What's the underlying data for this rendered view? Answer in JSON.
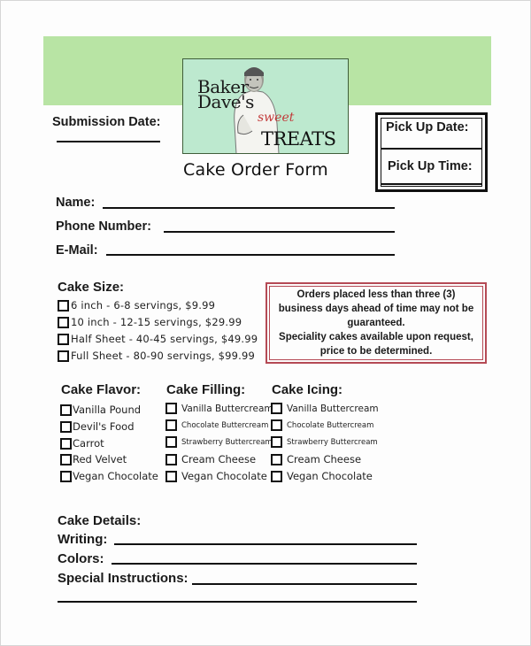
{
  "header": {
    "logo": {
      "line1": "Baker",
      "line2": "Dave's",
      "sweet": "sweet",
      "treats": "TREATS",
      "icon": "chef-photo"
    },
    "form_title": "Cake Order Form",
    "colors": {
      "band": "#b8e4a4",
      "logo_bg": "#bde9cf",
      "sweet_text": "#c23a3a",
      "note_border": "#b54a55"
    }
  },
  "submission": {
    "label": "Submission Date:"
  },
  "pickup": {
    "date_label": "Pick Up Date:",
    "time_label": "Pick Up Time:"
  },
  "contact": {
    "name_label": "Name:",
    "phone_label": "Phone Number:",
    "email_label": "E-Mail:"
  },
  "cake_size": {
    "heading": "Cake Size:",
    "options": [
      "6 inch - 6-8 servings, $9.99",
      "10 inch - 12-15 servings, $29.99",
      "Half Sheet - 40-45 servings, $49.99",
      "Full Sheet - 80-90 servings, $99.99"
    ]
  },
  "notice": {
    "line1": "Orders placed less than three (3)",
    "line2": "business days ahead of time may not be",
    "line3": "guaranteed.",
    "line4": "Speciality cakes available upon request,",
    "line5": "price to be determined."
  },
  "flavor": {
    "heading": "Cake Flavor:",
    "options": [
      "Vanilla Pound",
      "Devil's Food",
      "Carrot",
      "Red Velvet",
      "Vegan Chocolate"
    ]
  },
  "filling": {
    "heading": "Cake Filling:",
    "options": [
      "Vanilla Buttercream",
      "Chocolate Buttercream",
      "Strawberry Buttercream",
      "Cream Cheese",
      "Vegan Chocolate"
    ]
  },
  "icing": {
    "heading": "Cake Icing:",
    "options": [
      "Vanilla Buttercream",
      "Chocolate Buttercream",
      "Strawberry Buttercream",
      "Cream Cheese",
      "Vegan Chocolate"
    ]
  },
  "details": {
    "heading": "Cake Details:",
    "writing_label": "Writing:",
    "colors_label": "Colors:",
    "special_label": "Special Instructions:"
  }
}
